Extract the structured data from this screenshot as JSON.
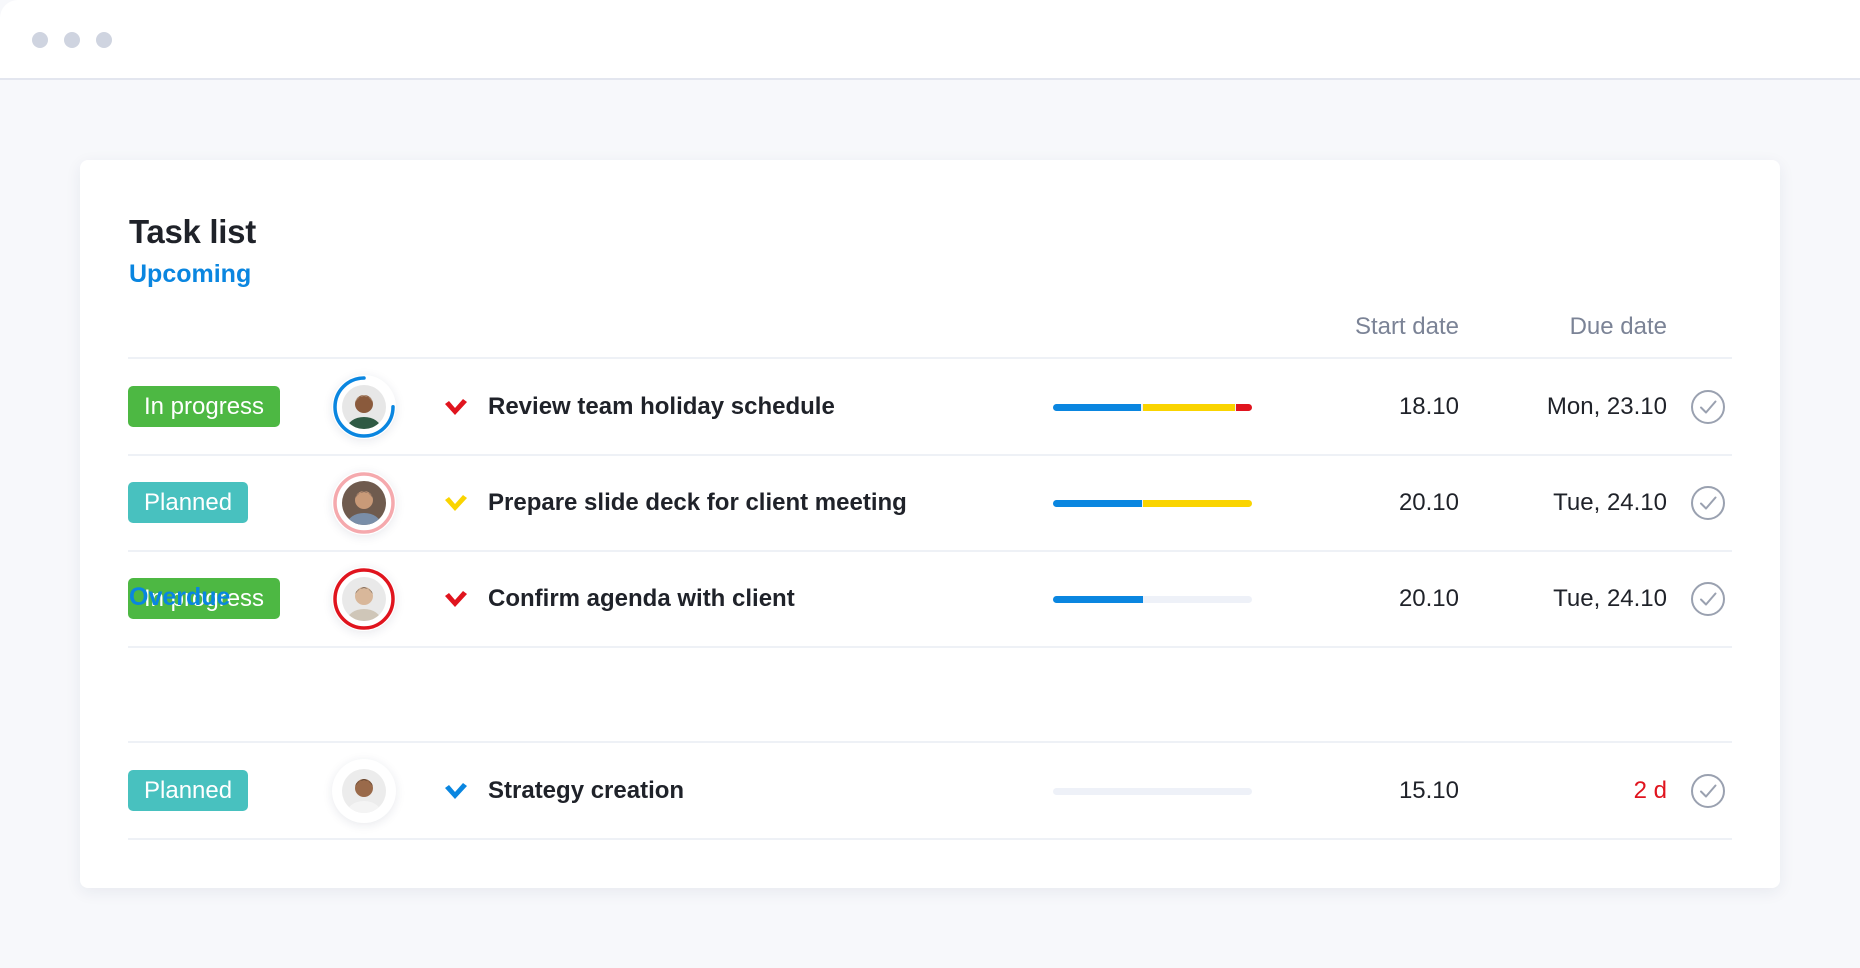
{
  "window": {
    "controls": [
      "window-dot",
      "window-dot",
      "window-dot"
    ]
  },
  "card": {
    "title": "Task list",
    "columns": {
      "start_date": "Start date",
      "due_date": "Due date"
    },
    "sections": [
      {
        "label": "Upcoming",
        "tasks": [
          {
            "status": "In progress",
            "status_type": "inprogress",
            "avatar_ring": {
              "color": "#0a86e0",
              "progress": 0.75,
              "style": "progress"
            },
            "priority_icon": "check-chevron-icon",
            "priority_color": "#e0141e",
            "name": "Review team holiday schedule",
            "progress_segments": [
              {
                "color": "#0a86e0",
                "fraction": 0.45
              },
              {
                "color": "#fad400",
                "fraction": 0.47
              },
              {
                "color": "#e0141e",
                "fraction": 0.08
              }
            ],
            "start_date": "18.10",
            "due_date": "Mon, 23.10",
            "due_overdue": false
          },
          {
            "status": "Planned",
            "status_type": "planned",
            "avatar_ring": {
              "color": "#f5a9ad",
              "progress": 1.0,
              "style": "full"
            },
            "priority_icon": "check-chevron-icon",
            "priority_color": "#fad400",
            "name": "Prepare slide deck for client meeting",
            "progress_segments": [
              {
                "color": "#0a86e0",
                "fraction": 0.45
              },
              {
                "color": "#fad400",
                "fraction": 0.55
              }
            ],
            "start_date": "20.10",
            "due_date": "Tue, 24.10",
            "due_overdue": false
          },
          {
            "status": "In progress",
            "status_type": "inprogress",
            "avatar_ring": {
              "color": "#e0141e",
              "progress": 1.0,
              "style": "full"
            },
            "priority_icon": "check-chevron-icon",
            "priority_color": "#e0141e",
            "name": "Confirm agenda with client",
            "progress_segments": [
              {
                "color": "#0a86e0",
                "fraction": 0.45
              }
            ],
            "start_date": "20.10",
            "due_date": "Tue, 24.10",
            "due_overdue": false
          }
        ]
      },
      {
        "label": "Overdue",
        "tasks": [
          {
            "status": "Planned",
            "status_type": "planned",
            "avatar_ring": {
              "color": "#ffffff",
              "progress": 0,
              "style": "none"
            },
            "priority_icon": "check-chevron-icon",
            "priority_color": "#0a86e0",
            "name": "Strategy creation",
            "progress_segments": [],
            "start_date": "15.10",
            "due_date": "2 d",
            "due_overdue": true
          }
        ]
      }
    ]
  },
  "colors": {
    "accent": "#0a86e0",
    "in_progress": "#4db843",
    "planned": "#48c1bf",
    "overdue": "#e0141e",
    "warning": "#fad400"
  }
}
